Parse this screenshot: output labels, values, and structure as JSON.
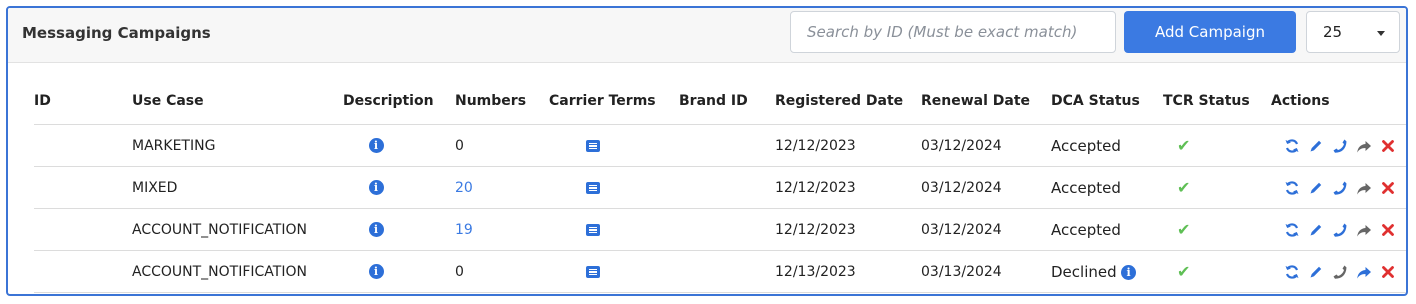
{
  "header": {
    "title": "Messaging Campaigns",
    "search_placeholder": "Search by ID (Must be exact match)",
    "add_label": "Add Campaign",
    "page_size": "25"
  },
  "columns": [
    "ID",
    "Use Case",
    "Description",
    "Numbers",
    "Carrier Terms",
    "Brand ID",
    "Registered Date",
    "Renewal Date",
    "DCA Status",
    "TCR Status",
    "Actions"
  ],
  "rows": [
    {
      "id": "",
      "use_case": "MARKETING",
      "numbers": "0",
      "numbers_link": false,
      "brand_id": "",
      "registered": "12/12/2023",
      "renewal": "03/12/2024",
      "dca_status": "Accepted",
      "dca_info": false,
      "phone_color": "#2d6fd8",
      "share_color": "#666666"
    },
    {
      "id": "",
      "use_case": "MIXED",
      "numbers": "20",
      "numbers_link": true,
      "brand_id": "",
      "registered": "12/12/2023",
      "renewal": "03/12/2024",
      "dca_status": "Accepted",
      "dca_info": false,
      "phone_color": "#2d6fd8",
      "share_color": "#666666"
    },
    {
      "id": "",
      "use_case": "ACCOUNT_NOTIFICATION",
      "numbers": "19",
      "numbers_link": true,
      "brand_id": "",
      "registered": "12/12/2023",
      "renewal": "03/12/2024",
      "dca_status": "Accepted",
      "dca_info": false,
      "phone_color": "#2d6fd8",
      "share_color": "#666666"
    },
    {
      "id": "",
      "use_case": "ACCOUNT_NOTIFICATION",
      "numbers": "0",
      "numbers_link": false,
      "brand_id": "",
      "registered": "12/13/2023",
      "renewal": "03/13/2024",
      "dca_status": "Declined",
      "dca_info": true,
      "phone_color": "#666666",
      "share_color": "#2d6fd8"
    }
  ],
  "icons": {
    "description": "info-icon",
    "carrier_terms": "list-icon",
    "tcr_status": "check-icon",
    "actions": [
      "refresh-icon",
      "edit-icon",
      "phone-icon",
      "share-icon",
      "delete-icon"
    ]
  },
  "colors": {
    "accent": "#3b7ae2",
    "check": "#5fbf55",
    "delete": "#e03030",
    "border": "#3b74d6"
  }
}
